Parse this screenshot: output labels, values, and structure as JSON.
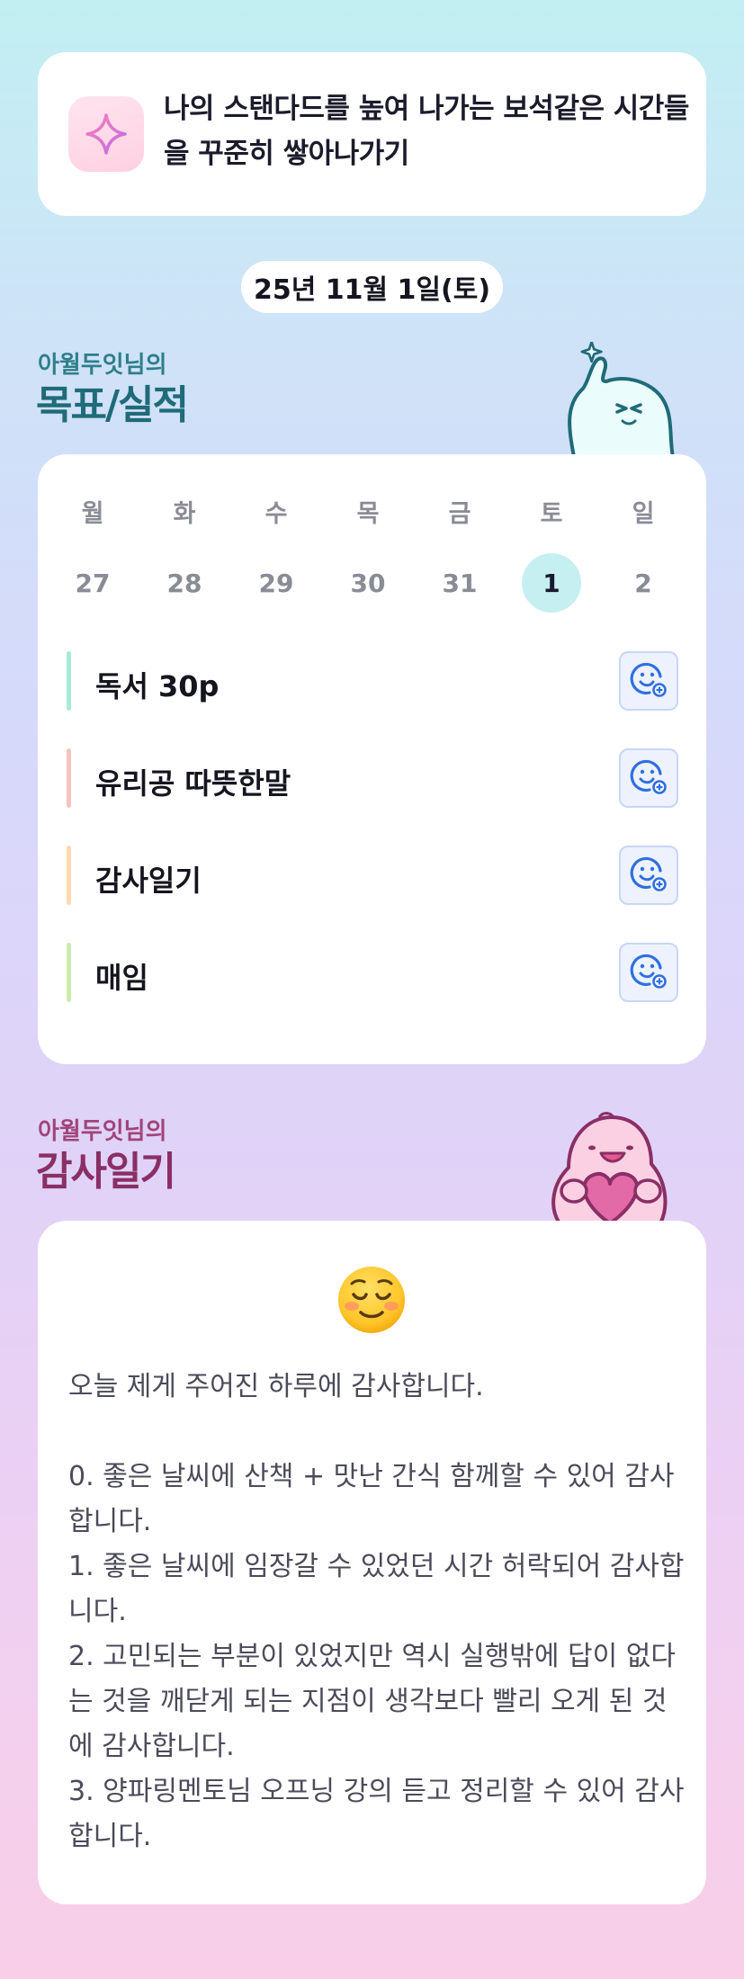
{
  "motto": {
    "icon": "sparkle-icon",
    "text": "나의 스탠다드를 높여 나가는 보석같은 시간들을 꾸준히 쌓아나가기"
  },
  "date": "25년 11월 1일(토)",
  "goals_section": {
    "subtitle": "아월두잇님의",
    "title": "목표/실적",
    "weekdays": [
      "월",
      "화",
      "수",
      "목",
      "금",
      "토",
      "일"
    ],
    "dates": [
      "27",
      "28",
      "29",
      "30",
      "31",
      "1",
      "2"
    ],
    "selected_index": 5,
    "items": [
      {
        "label": "독서 30p",
        "color": "#a9ead7"
      },
      {
        "label": "유리공 따뜻한말",
        "color": "#f7c3bd"
      },
      {
        "label": "감사일기",
        "color": "#fbd9b4"
      },
      {
        "label": "매임",
        "color": "#c9edb0"
      }
    ]
  },
  "gratitude_section": {
    "subtitle": "아월두잇님의",
    "title": "감사일기",
    "emoji": "☺️",
    "body": "오늘 제게 주어진 하루에 감사합니다.\n\n0. 좋은 날씨에 산책 + 맛난 간식 함께할 수 있어 감사합니다.\n1. 좋은 날씨에 임장갈 수 있었던 시간 허락되어 감사합니다.\n2. 고민되는 부분이 있었지만 역시 실행밖에 답이 없다는 것을 깨닫게 되는 지점이 생각보다 빨리 오게 된 것에 감사합니다.\n3. 양파링멘토님 오프닝 강의 듣고 정리할 수 있어 감사합니다."
  },
  "colors": {
    "accent_teal": "#1f6b78",
    "accent_pink": "#8a2f66",
    "selected_day": "#c6eff1",
    "reaction_icon": "#2f6fe0"
  }
}
